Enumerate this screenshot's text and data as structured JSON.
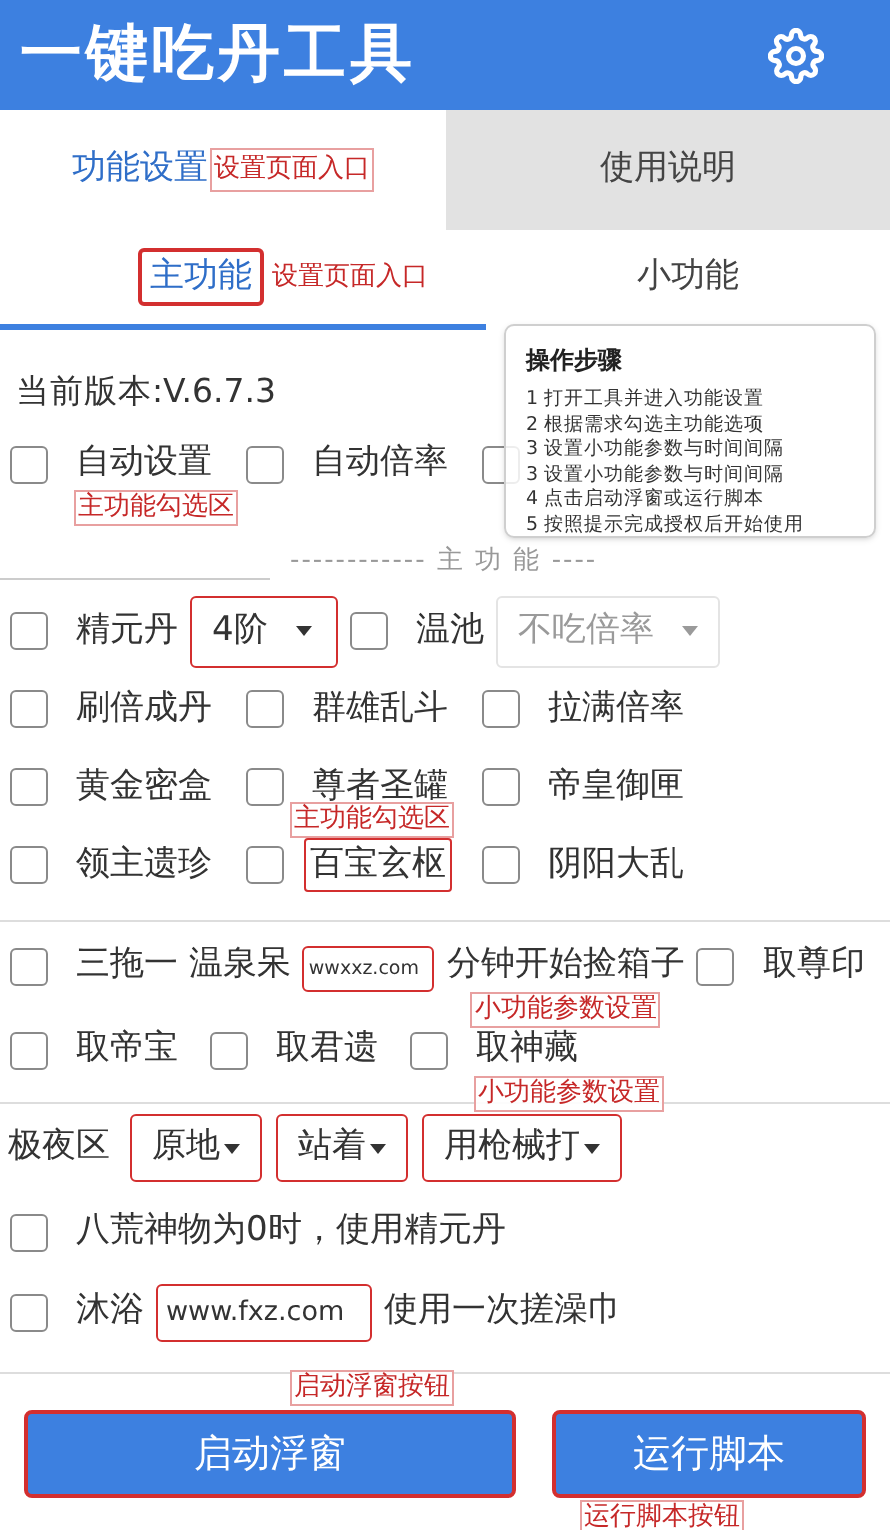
{
  "header": {
    "title": "一键吃丹工具"
  },
  "tabs": [
    {
      "label": "功能设置",
      "selected": true,
      "note": "设置页面入口"
    },
    {
      "label": "使用说明",
      "selected": false
    }
  ],
  "subtabs": [
    {
      "label": "主功能",
      "selected": true,
      "outlined": true,
      "note": "设置页面入口"
    },
    {
      "label": "小功能",
      "selected": false
    }
  ],
  "help_popup": {
    "title": "操作步骤",
    "steps": [
      "1  打开工具并进入功能设置",
      "2  根据需求勾选主功能选项",
      "3  设置小功能参数与时间间隔",
      "3  设置小功能参数与时间间隔",
      "4  点击启动浮窗或运行脚本",
      "5  按照提示完成授权后开始使用"
    ]
  },
  "version": "当前版本:V.6.7.3",
  "top_options": [
    {
      "kind": "checkbox",
      "label": "自动设置",
      "checked": false,
      "note": "主功能勾选区"
    },
    {
      "kind": "checkbox",
      "label": "自动倍率",
      "checked": false
    },
    {
      "kind": "checkbox",
      "checked": false
    }
  ],
  "divider_label": "------------ 主 功 能 ----",
  "main_rows": [
    {
      "kind": "flow",
      "items": [
        {
          "kind": "checkbox",
          "label": "精元丹",
          "checked": false
        },
        {
          "kind": "dropdown",
          "value": "4阶",
          "outlined": true,
          "disabled": false
        },
        {
          "kind": "checkbox",
          "label": "温池",
          "checked": false
        },
        {
          "kind": "dropdown",
          "value": "不吃倍率",
          "outlined": false,
          "disabled": true
        }
      ]
    },
    {
      "kind": "grid",
      "items": [
        {
          "kind": "checkbox",
          "label": "刷倍成丹",
          "checked": false
        },
        {
          "kind": "checkbox",
          "label": "群雄乱斗",
          "checked": false
        },
        {
          "kind": "checkbox",
          "label": "拉满倍率",
          "checked": false
        }
      ]
    },
    {
      "kind": "grid",
      "items": [
        {
          "kind": "checkbox",
          "label": "黄金密盒",
          "checked": false
        },
        {
          "kind": "checkbox",
          "label": "尊者圣罐",
          "checked": false
        },
        {
          "kind": "checkbox",
          "label": "帝皇御匣",
          "checked": false
        }
      ]
    },
    {
      "kind": "grid",
      "items": [
        {
          "kind": "checkbox",
          "label": "领主遗珍",
          "checked": false
        },
        {
          "kind": "checkbox",
          "label": "百宝玄枢",
          "checked": false,
          "outlined": true,
          "note_above": "主功能勾选区"
        },
        {
          "kind": "checkbox",
          "label": "阴阳大乱",
          "checked": false
        }
      ]
    }
  ],
  "small_rows": [
    {
      "kind": "flow",
      "items": [
        {
          "kind": "checkbox",
          "label": "三拖一 温泉呆",
          "checked": false
        },
        {
          "kind": "input",
          "value": "wwxxz.com",
          "small": true
        },
        {
          "kind": "text",
          "label": "分钟开始捡箱子",
          "note": "小功能参数设置"
        },
        {
          "kind": "checkbox",
          "label": "取尊印",
          "checked": false
        }
      ]
    },
    {
      "kind": "wide",
      "items": [
        {
          "kind": "checkbox",
          "label": "取帝宝",
          "checked": false
        },
        {
          "kind": "checkbox",
          "label": "取君遗",
          "checked": false
        },
        {
          "kind": "checkbox",
          "label": "取神藏",
          "checked": false,
          "note": "小功能参数设置"
        }
      ]
    }
  ],
  "night_zone": {
    "label": "极夜区",
    "dropdowns": [
      {
        "value": "原地"
      },
      {
        "value": "站着"
      },
      {
        "value": "用枪械打"
      }
    ]
  },
  "extra_rows": [
    {
      "kind": "flow",
      "items": [
        {
          "kind": "checkbox",
          "label": "八荒神物为0时，使用精元丹",
          "checked": false
        }
      ]
    },
    {
      "kind": "flow",
      "items": [
        {
          "kind": "checkbox",
          "label": "沐浴",
          "checked": false
        },
        {
          "kind": "input",
          "value": "www.fxz.com",
          "small": false
        },
        {
          "kind": "text",
          "label": "使用一次搓澡巾"
        }
      ]
    }
  ],
  "buttons": [
    {
      "label": "启动浮窗",
      "note_above": "启动浮窗按钮"
    },
    {
      "label": "运行脚本",
      "note": "运行脚本按钮"
    }
  ]
}
